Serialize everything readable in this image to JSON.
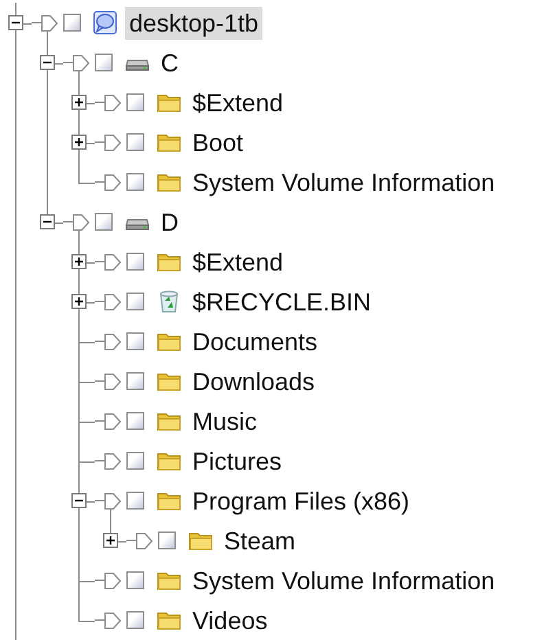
{
  "tree": [
    {
      "label": "desktop-1tb",
      "kind": "computer",
      "expanded": true,
      "checked": false,
      "selected": true,
      "children": [
        {
          "label": "C",
          "kind": "drive",
          "expanded": true,
          "checked": false,
          "selected": false,
          "children": [
            {
              "label": "$Extend",
              "kind": "folder",
              "expanded": false,
              "checked": false,
              "selected": false
            },
            {
              "label": "Boot",
              "kind": "folder",
              "expanded": false,
              "checked": false,
              "selected": false
            },
            {
              "label": "System Volume Information",
              "kind": "folder",
              "checked": false,
              "selected": false
            }
          ]
        },
        {
          "label": "D",
          "kind": "drive",
          "expanded": true,
          "checked": false,
          "selected": false,
          "children": [
            {
              "label": "$Extend",
              "kind": "folder",
              "expanded": false,
              "checked": false,
              "selected": false
            },
            {
              "label": "$RECYCLE.BIN",
              "kind": "recycle",
              "expanded": false,
              "checked": false,
              "selected": false
            },
            {
              "label": "Documents",
              "kind": "folder",
              "checked": false,
              "selected": false
            },
            {
              "label": "Downloads",
              "kind": "folder",
              "checked": false,
              "selected": false
            },
            {
              "label": "Music",
              "kind": "folder",
              "checked": false,
              "selected": false
            },
            {
              "label": "Pictures",
              "kind": "folder",
              "checked": false,
              "selected": false
            },
            {
              "label": "Program Files (x86)",
              "kind": "folder",
              "expanded": true,
              "checked": false,
              "selected": false,
              "children": [
                {
                  "label": "Steam",
                  "kind": "folder",
                  "expanded": false,
                  "checked": false,
                  "selected": false
                }
              ]
            },
            {
              "label": "System Volume Information",
              "kind": "folder",
              "checked": false,
              "selected": false
            },
            {
              "label": "Videos",
              "kind": "folder",
              "checked": false,
              "selected": false
            }
          ]
        }
      ]
    }
  ]
}
